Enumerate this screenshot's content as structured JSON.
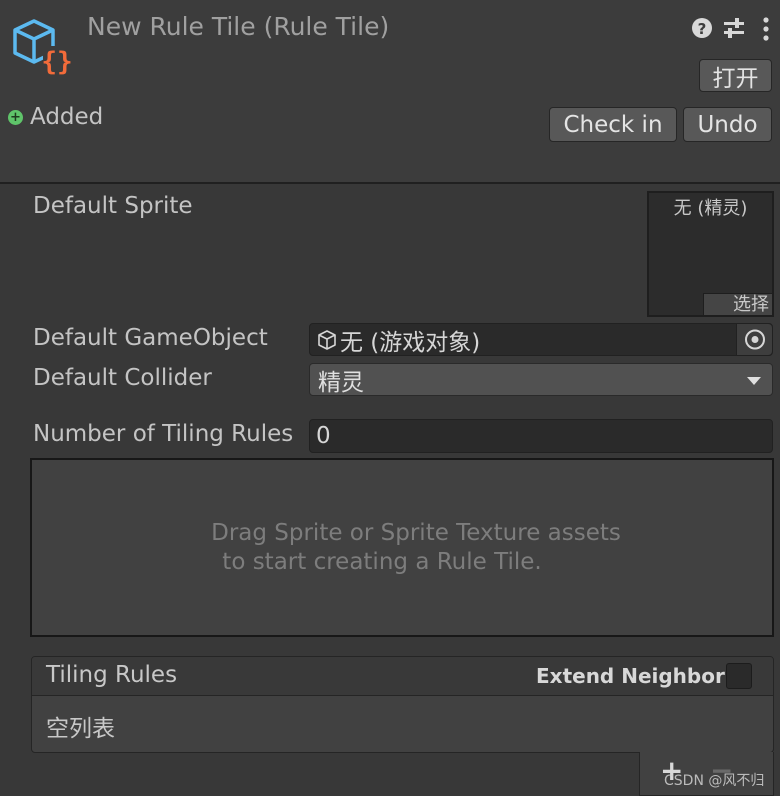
{
  "header": {
    "title": "New Rule Tile (Rule Tile)",
    "status": "Added",
    "open_button": "打开",
    "check_in_button": "Check in",
    "undo_button": "Undo",
    "help_icon": "?"
  },
  "fields": {
    "default_sprite_label": "Default Sprite",
    "sprite_none": "无 (精灵)",
    "sprite_select": "选择",
    "default_gameobject_label": "Default GameObject",
    "gameobject_value": "无 (游戏对象)",
    "default_collider_label": "Default Collider",
    "collider_value": "精灵",
    "tiling_rules_count_label": "Number of Tiling Rules",
    "tiling_rules_count": "0"
  },
  "dropzone": {
    "line1": "Drag Sprite or Sprite Texture assets",
    "line2": "to start creating a Rule Tile."
  },
  "tiling_rules": {
    "header": "Tiling Rules",
    "extend_neighbor_label": "Extend Neighbor",
    "empty_text": "空列表",
    "add_icon": "+",
    "remove_icon": "−"
  },
  "watermark": "CSDN @风不归",
  "colors": {
    "background": "#383838",
    "header": "#3c3c3c",
    "accent_orange": "#f26b3a",
    "accent_blue": "#5cbaf0",
    "added_green": "#5fc46a"
  }
}
